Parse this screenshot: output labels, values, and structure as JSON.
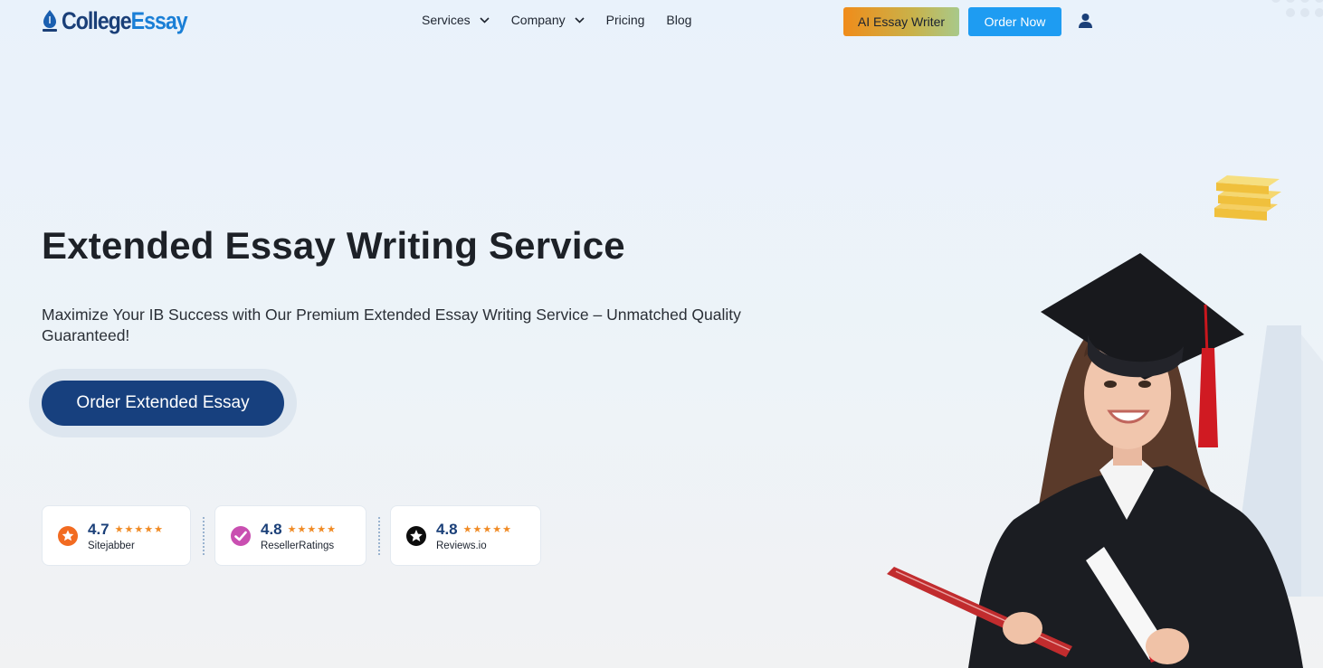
{
  "header": {
    "logo": {
      "part1": "College",
      "part2": "Essay"
    },
    "nav": [
      {
        "label": "Services",
        "has_dropdown": true
      },
      {
        "label": "Company",
        "has_dropdown": true
      },
      {
        "label": "Pricing",
        "has_dropdown": false
      },
      {
        "label": "Blog",
        "has_dropdown": false
      }
    ],
    "ai_button": "AI Essay Writer",
    "order_button": "Order Now",
    "user_icon": "user-icon"
  },
  "hero": {
    "title": "Extended Essay Writing Service",
    "subtitle": "Maximize Your IB Success with Our Premium Extended Essay Writing Service – Unmatched Quality Guaranteed!",
    "cta": "Order Extended Essay"
  },
  "ratings": [
    {
      "score": "4.7",
      "stars": "★★★★★",
      "name": "Sitejabber",
      "icon": "sitejabber-icon"
    },
    {
      "score": "4.8",
      "stars": "★★★★★",
      "name": "ResellerRatings",
      "icon": "resellerratings-icon"
    },
    {
      "score": "4.8",
      "stars": "★★★★★",
      "name": "Reviews.io",
      "icon": "reviewsio-icon"
    }
  ],
  "colors": {
    "brand_dark": "#17407e",
    "brand_blue": "#1e9cf2",
    "star": "#f08a24",
    "ai_gradient_start": "#f08c1a",
    "ai_gradient_end": "#a8c98a"
  }
}
